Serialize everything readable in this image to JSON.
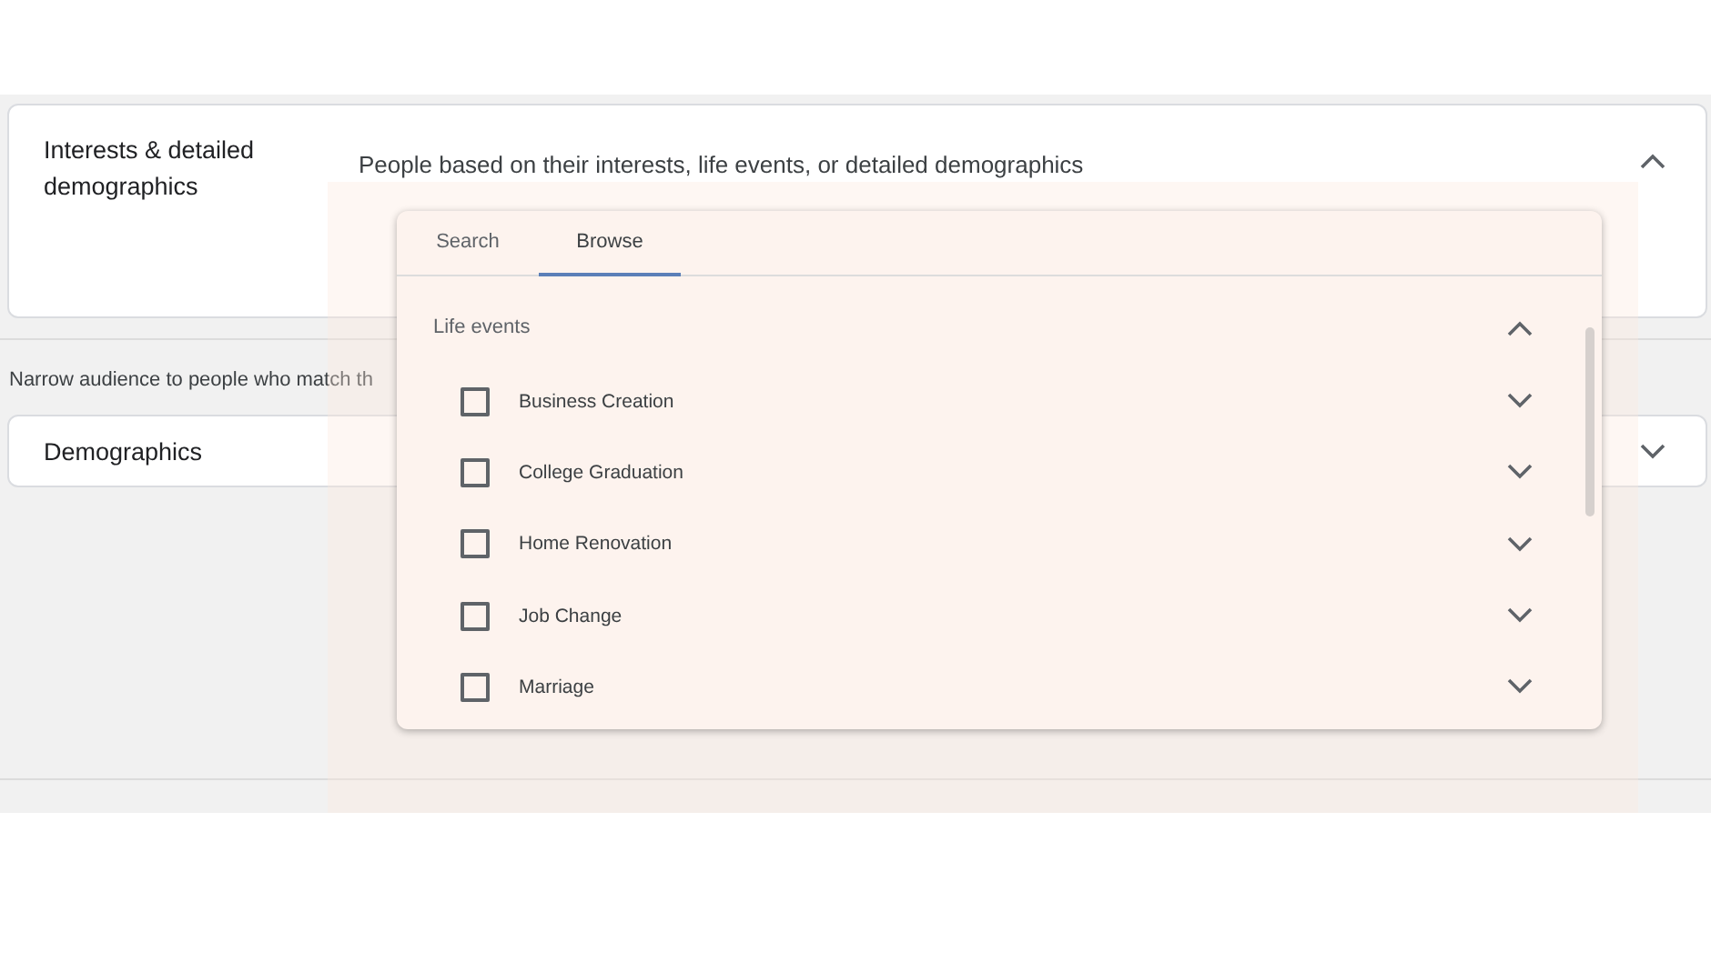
{
  "interests_card": {
    "title": "Interests & detailed demographics",
    "description": "People based on their interests, life events, or detailed demographics",
    "expanded": true
  },
  "narrow_note": "Narrow audience to people who match th",
  "demographics_card": {
    "title": "Demographics",
    "expanded": false
  },
  "picker": {
    "tabs": [
      {
        "label": "Search",
        "selected": false
      },
      {
        "label": "Browse",
        "selected": true
      }
    ],
    "group": {
      "label": "Life events",
      "expanded": true,
      "items": [
        {
          "label": "Business Creation",
          "checked": false,
          "expanded": false
        },
        {
          "label": "College Graduation",
          "checked": false,
          "expanded": false
        },
        {
          "label": "Home Renovation",
          "checked": false,
          "expanded": false
        },
        {
          "label": "Job Change",
          "checked": false,
          "expanded": false
        },
        {
          "label": "Marriage",
          "checked": false,
          "expanded": false
        }
      ]
    }
  }
}
